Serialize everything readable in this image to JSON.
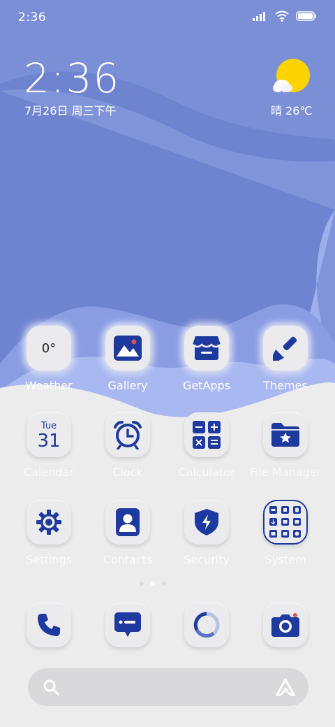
{
  "status_bar": {
    "time": "2:36"
  },
  "clock_widget": {
    "time": "2:36",
    "date": "7月26日 周三下午"
  },
  "weather_widget": {
    "text": "晴 26℃"
  },
  "apps_row1": [
    {
      "name": "weather",
      "label": "Weather",
      "tile_text": "0°"
    },
    {
      "name": "gallery",
      "label": "Gallery"
    },
    {
      "name": "getapps",
      "label": "GetApps"
    },
    {
      "name": "themes",
      "label": "Themes"
    }
  ],
  "apps_row2": [
    {
      "name": "calendar",
      "label": "Calendar",
      "day": "Tue",
      "date": "31"
    },
    {
      "name": "clock",
      "label": "Clock"
    },
    {
      "name": "calculator",
      "label": "Calculator"
    },
    {
      "name": "file-manager",
      "label": "File Manager"
    }
  ],
  "apps_row3": [
    {
      "name": "settings",
      "label": "Settings"
    },
    {
      "name": "contacts",
      "label": "Contacts"
    },
    {
      "name": "security",
      "label": "Security"
    },
    {
      "name": "system",
      "label": "System"
    }
  ],
  "dock": [
    "phone",
    "messages",
    "browser",
    "camera"
  ],
  "page_indicator": {
    "pages": 3,
    "current": 2
  },
  "colors": {
    "icon_blue": "#1e3a9e",
    "tile": "#ebebed",
    "accent_red": "#e0504f",
    "sun": "#fdd400"
  }
}
